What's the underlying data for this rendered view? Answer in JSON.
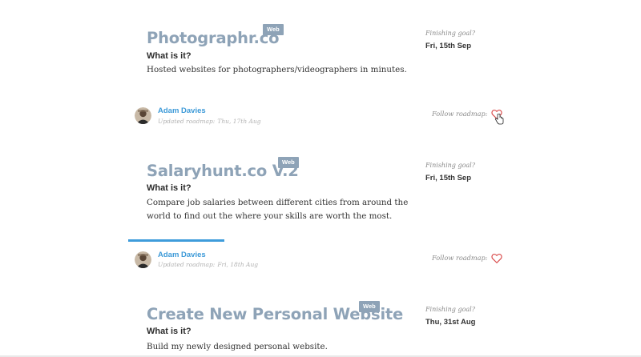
{
  "projects": [
    {
      "title": "Photographr.co",
      "tag": "Web",
      "what_label": "What is it?",
      "description": "Hosted websites for photographers/videographers in minutes.",
      "goal_label": "Finishing goal?",
      "goal_date": "Fri, 15th Sep",
      "author": "Adam Davies",
      "updated_label": "Updated roadmap:",
      "updated_date": "Thu, 17th Aug",
      "follow_label": "Follow roadmap:"
    },
    {
      "title": "Salaryhunt.co V.2",
      "tag": "Web",
      "what_label": "What is it?",
      "description": "Compare job salaries between different cities from around the world to find out the where your skills are worth the most.",
      "goal_label": "Finishing goal?",
      "goal_date": "Fri, 15th Sep",
      "author": "Adam Davies",
      "updated_label": "Updated roadmap:",
      "updated_date": "Fri, 18th Aug",
      "follow_label": "Follow roadmap:"
    },
    {
      "title": "Create New Personal Website",
      "tag": "Web",
      "what_label": "What is it?",
      "description": "Build my newly designed personal website.",
      "goal_label": "Finishing goal?",
      "goal_date": "Thu, 31st Aug"
    }
  ],
  "colors": {
    "title": "#8ea3b7",
    "accent": "#3e9cdb",
    "heart": "#d94a4a"
  },
  "icons": {
    "follow": "heart-outline-icon",
    "cursor": "hand-pointer-icon"
  }
}
